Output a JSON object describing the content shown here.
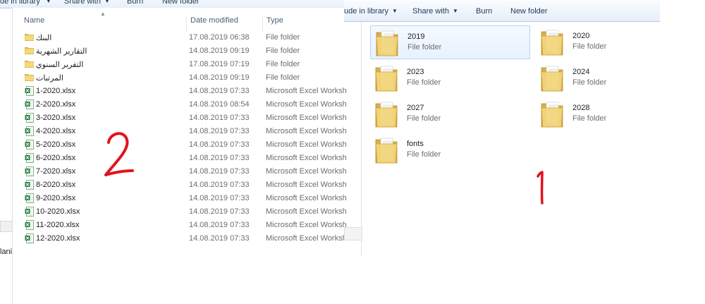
{
  "left_toolbar": {
    "include_label": "de in library",
    "share_label": "Share with",
    "burn_label": "Burn",
    "new_folder_label": "New folder"
  },
  "right_toolbar": {
    "include_label": "ude in library",
    "share_label": "Share with",
    "burn_label": "Burn",
    "new_folder_label": "New folder"
  },
  "columns": {
    "name": "Name",
    "date": "Date modified",
    "type": "Type"
  },
  "rows": [
    {
      "name": "البنك",
      "date": "17.08.2019 06:38",
      "type": "File folder",
      "icon": "folder-icon"
    },
    {
      "name": "التقارير الشهرية",
      "date": "14.08.2019 09:19",
      "type": "File folder",
      "icon": "folder-icon"
    },
    {
      "name": "التقرير السنوي",
      "date": "17.08.2019 07:19",
      "type": "File folder",
      "icon": "folder-icon"
    },
    {
      "name": "المرتبات",
      "date": "14.08.2019 09:19",
      "type": "File folder",
      "icon": "folder-icon"
    },
    {
      "name": "1-2020.xlsx",
      "date": "14.08.2019 07:33",
      "type": "Microsoft Excel Worksh",
      "icon": "excel-icon"
    },
    {
      "name": "2-2020.xlsx",
      "date": "14.08.2019 08:54",
      "type": "Microsoft Excel Worksh",
      "icon": "excel-icon"
    },
    {
      "name": "3-2020.xlsx",
      "date": "14.08.2019 07:33",
      "type": "Microsoft Excel Worksh",
      "icon": "excel-icon"
    },
    {
      "name": "4-2020.xlsx",
      "date": "14.08.2019 07:33",
      "type": "Microsoft Excel Worksh",
      "icon": "excel-icon"
    },
    {
      "name": "5-2020.xlsx",
      "date": "14.08.2019 07:33",
      "type": "Microsoft Excel Worksh",
      "icon": "excel-icon"
    },
    {
      "name": "6-2020.xlsx",
      "date": "14.08.2019 07:33",
      "type": "Microsoft Excel Worksh",
      "icon": "excel-icon"
    },
    {
      "name": "7-2020.xlsx",
      "date": "14.08.2019 07:33",
      "type": "Microsoft Excel Worksh",
      "icon": "excel-icon"
    },
    {
      "name": "8-2020.xlsx",
      "date": "14.08.2019 07:33",
      "type": "Microsoft Excel Worksh",
      "icon": "excel-icon"
    },
    {
      "name": "9-2020.xlsx",
      "date": "14.08.2019 07:33",
      "type": "Microsoft Excel Worksh",
      "icon": "excel-icon"
    },
    {
      "name": "10-2020.xlsx",
      "date": "14.08.2019 07:33",
      "type": "Microsoft Excel Worksh",
      "icon": "excel-icon"
    },
    {
      "name": "11-2020.xlsx",
      "date": "14.08.2019 07:33",
      "type": "Microsoft Excel Worksh",
      "icon": "excel-icon"
    },
    {
      "name": "12-2020.xlsx",
      "date": "14.08.2019 07:33",
      "type": "Microsoft Excel Worksh",
      "icon": "excel-icon"
    }
  ],
  "tiles": [
    {
      "name": "2019",
      "type": "File folder",
      "selected": true
    },
    {
      "name": "2020",
      "type": "File folder"
    },
    {
      "name": "2023",
      "type": "File folder"
    },
    {
      "name": "2024",
      "type": "File folder"
    },
    {
      "name": "2027",
      "type": "File folder"
    },
    {
      "name": "2028",
      "type": "File folder"
    },
    {
      "name": "fonts",
      "type": "File folder"
    }
  ],
  "sidebar_truncated": "lani",
  "annotations": {
    "left_number": "2",
    "right_number": "1",
    "color": "#e0141e"
  },
  "colors": {
    "toolbar_text": "#1e395b",
    "selection_border": "#b6d1f2",
    "header_text": "#4c607a"
  }
}
